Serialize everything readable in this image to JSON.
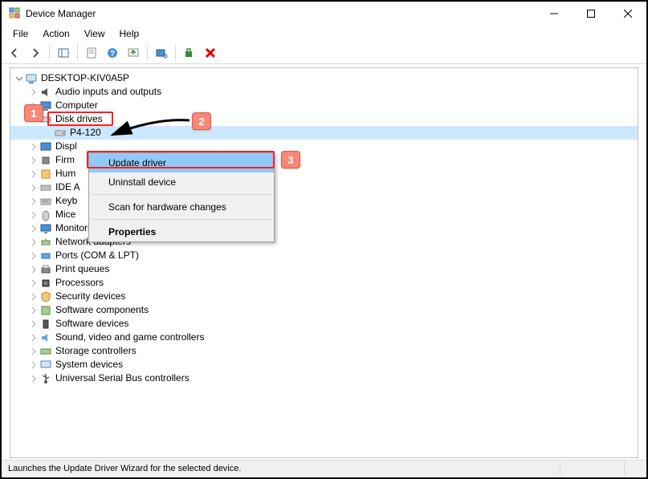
{
  "window": {
    "title": "Device Manager"
  },
  "menu": {
    "file": "File",
    "action": "Action",
    "view": "View",
    "help": "Help"
  },
  "tree": {
    "root": "DESKTOP-KIV0A5P",
    "audio": "Audio inputs and outputs",
    "computer": "Computer",
    "disk_drives": "Disk drives",
    "disk_child": "P4-120",
    "display": "Displ",
    "firmware": "Firm",
    "hid": "Hum",
    "ide": "IDE A",
    "keyboards": "Keyb",
    "mice": "Mice",
    "monitors": "Monitors",
    "network": "Network adapters",
    "ports": "Ports (COM & LPT)",
    "print_queues": "Print queues",
    "processors": "Processors",
    "security": "Security devices",
    "soft_components": "Software components",
    "soft_devices": "Software devices",
    "sound": "Sound, video and game controllers",
    "storage": "Storage controllers",
    "system": "System devices",
    "usb": "Universal Serial Bus controllers"
  },
  "context_menu": {
    "update_driver": "Update driver",
    "uninstall": "Uninstall device",
    "scan": "Scan for hardware changes",
    "properties": "Properties"
  },
  "status": {
    "text": "Launches the Update Driver Wizard for the selected device."
  },
  "annotations": {
    "c1": "1",
    "c2": "2",
    "c3": "3"
  }
}
